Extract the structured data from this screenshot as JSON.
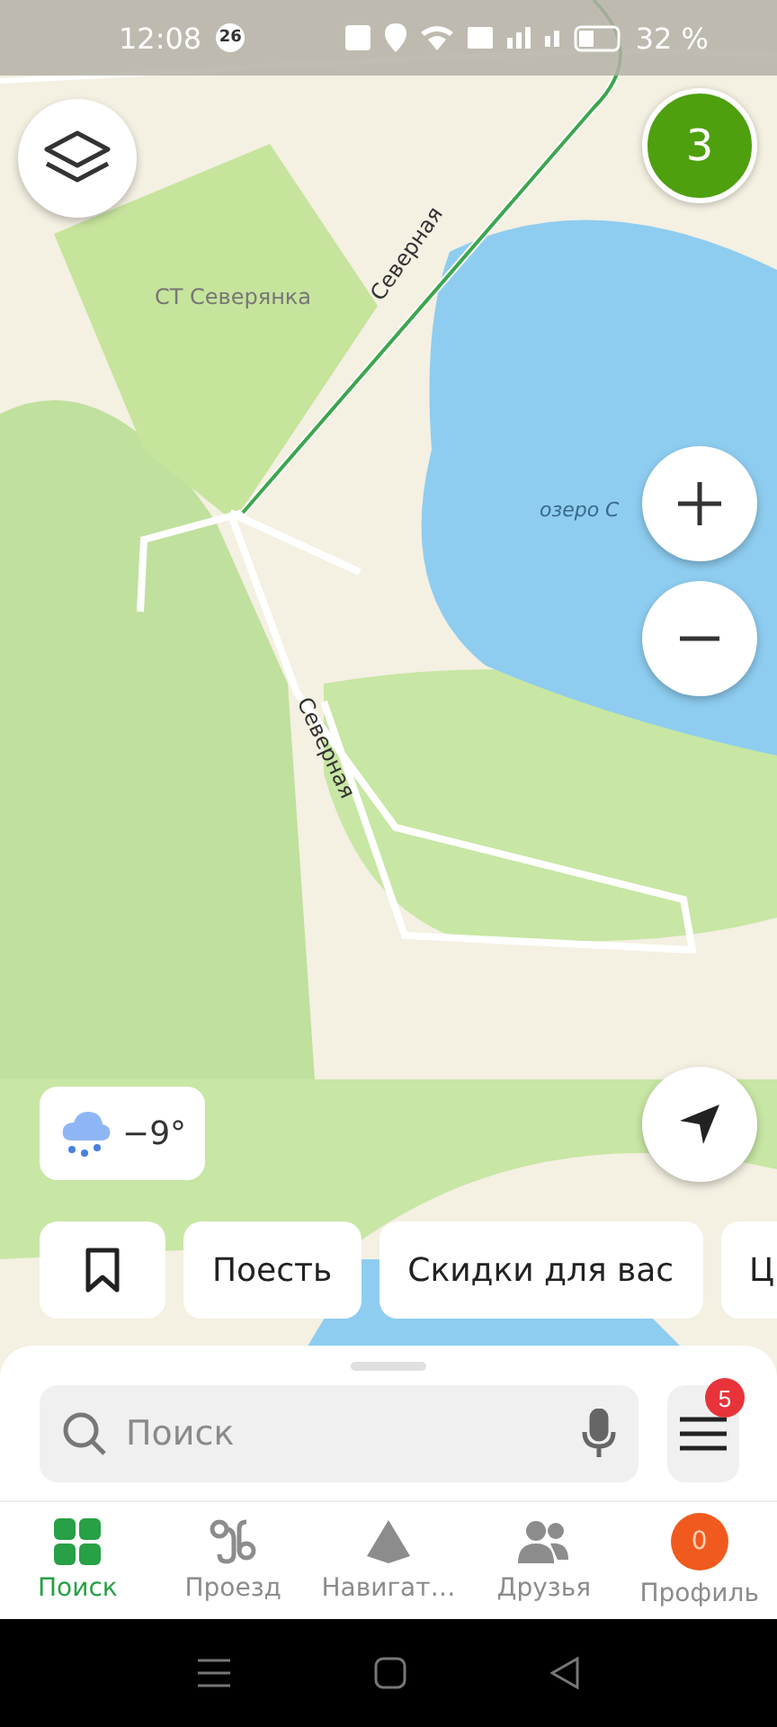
{
  "status_bar": {
    "time": "12:08",
    "notification_count": "26",
    "battery": "32 %"
  },
  "map": {
    "labels": [
      {
        "text": "СТ Северянка",
        "kind": "area"
      },
      {
        "text": "Северная",
        "kind": "street"
      },
      {
        "text": "Северная",
        "kind": "street"
      },
      {
        "text": "озеро С",
        "kind": "water"
      }
    ]
  },
  "cluster": {
    "count": "3"
  },
  "weather": {
    "temperature": "−9°"
  },
  "chips": [
    {
      "kind": "bookmark"
    },
    {
      "kind": "text",
      "label": "Поесть"
    },
    {
      "kind": "text",
      "label": "Скидки для вас"
    },
    {
      "kind": "text",
      "label": "Ц"
    }
  ],
  "search": {
    "placeholder": "Поиск"
  },
  "menu": {
    "badge": "5"
  },
  "tabs": [
    {
      "label": "Поиск",
      "kind": "search",
      "selected": true
    },
    {
      "label": "Проезд",
      "kind": "route",
      "selected": false
    },
    {
      "label": "Навигат…",
      "kind": "navigator",
      "selected": false
    },
    {
      "label": "Друзья",
      "kind": "friends",
      "selected": false
    },
    {
      "label": "Профиль",
      "kind": "profile",
      "selected": false,
      "avatar": "0"
    }
  ]
}
